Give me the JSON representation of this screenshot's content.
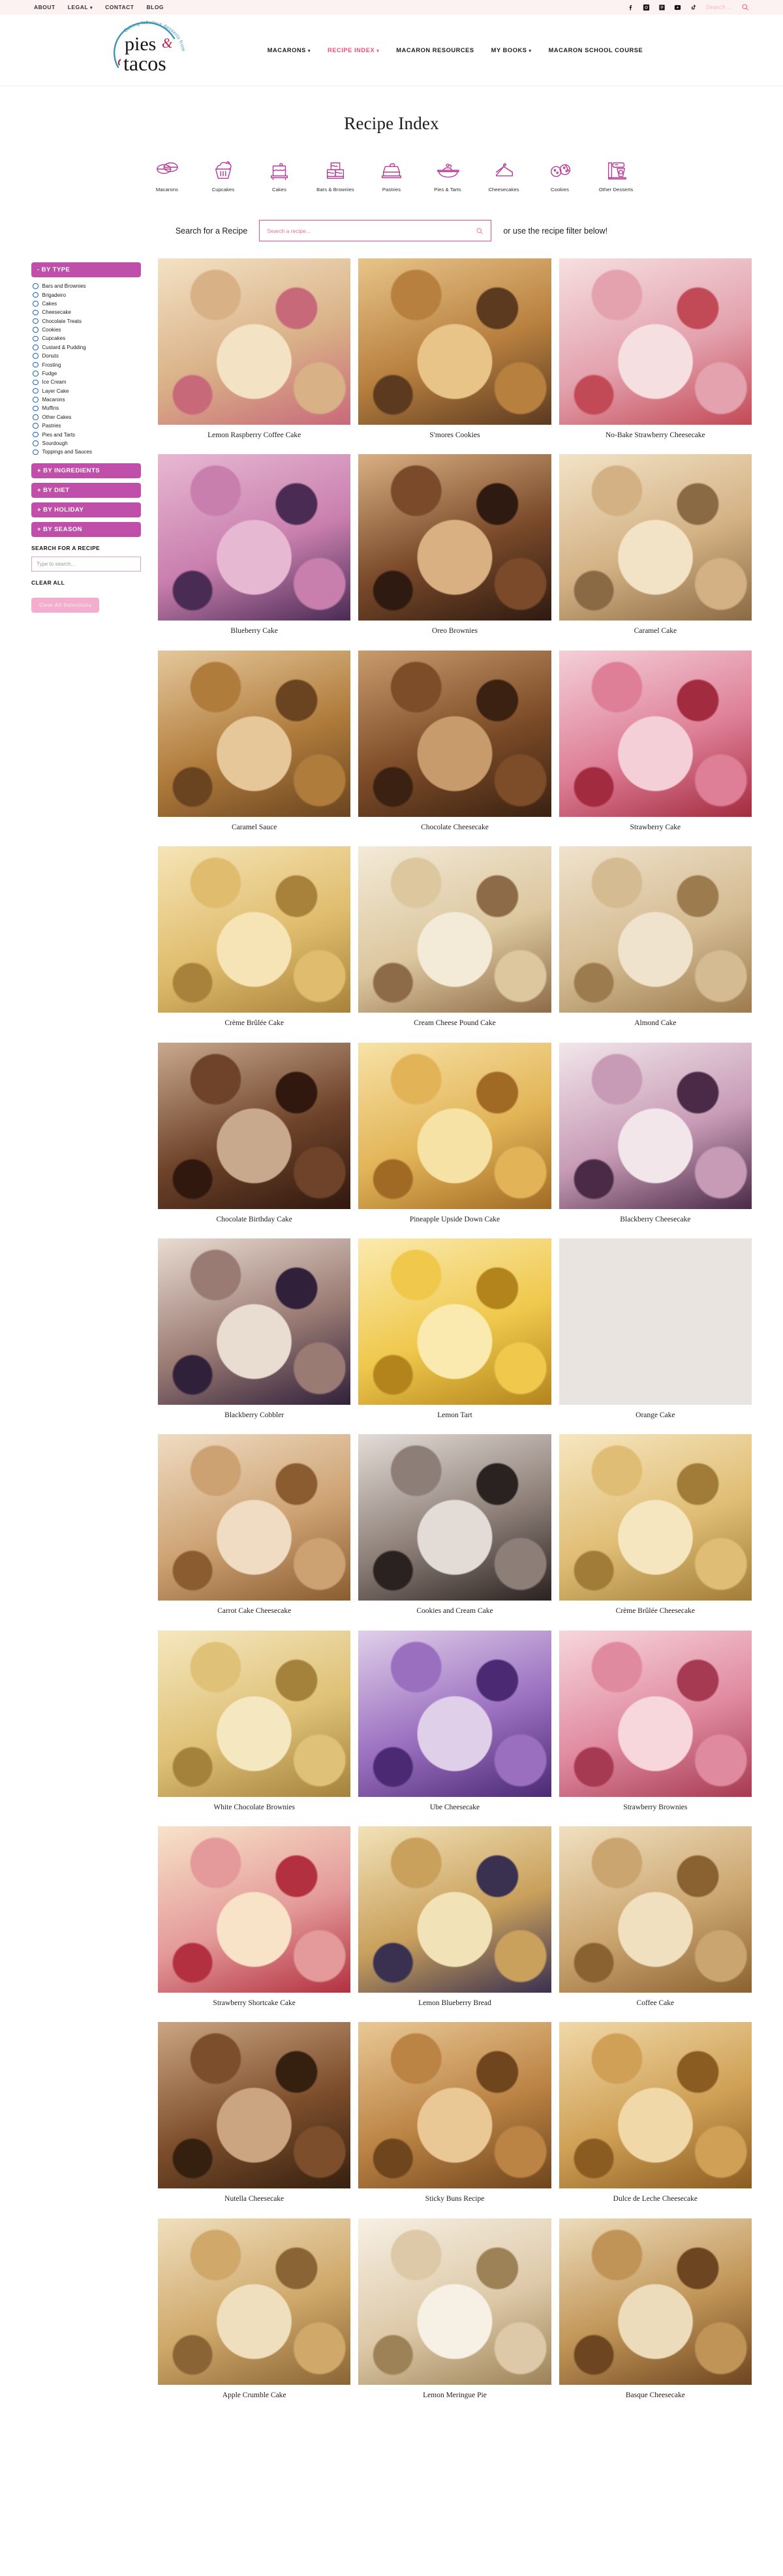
{
  "topbar": {
    "links": [
      {
        "label": "ABOUT",
        "caret": false
      },
      {
        "label": "LEGAL",
        "caret": true
      },
      {
        "label": "CONTACT",
        "caret": false
      },
      {
        "label": "BLOG",
        "caret": false
      }
    ],
    "social": [
      "facebook-icon",
      "instagram-icon",
      "pinterest-icon",
      "youtube-icon",
      "tiktok-icon"
    ],
    "search_placeholder": "Search ...",
    "search_value": ""
  },
  "brand": {
    "line1": "pies",
    "amp": "&",
    "line2": "tacos",
    "ring_text": "Baking fabulous desserts from scratch"
  },
  "mainnav": [
    {
      "label": "MACARONS",
      "caret": true,
      "active": false
    },
    {
      "label": "RECIPE INDEX",
      "caret": true,
      "active": true
    },
    {
      "label": "MACARON RESOURCES",
      "caret": false,
      "active": false
    },
    {
      "label": "MY BOOKS",
      "caret": true,
      "active": false
    },
    {
      "label": "MACARON SCHOOL COURSE",
      "caret": false,
      "active": false
    }
  ],
  "page": {
    "title": "Recipe Index",
    "accent": "#ef4d7e",
    "filter_purple": "#bf4fa8",
    "icon_purple": "#b63b9a"
  },
  "categories": [
    {
      "label": "Macarons",
      "icon": "macaron-icon"
    },
    {
      "label": "Cupcakes",
      "icon": "cupcake-icon"
    },
    {
      "label": "Cakes",
      "icon": "cake-icon"
    },
    {
      "label": "Bars & Brownies",
      "icon": "brownies-icon"
    },
    {
      "label": "Pastries",
      "icon": "pastry-icon"
    },
    {
      "label": "Pies & Tarts",
      "icon": "pie-icon"
    },
    {
      "label": "Cheesecakes",
      "icon": "cheesecake-slice-icon"
    },
    {
      "label": "Cookies",
      "icon": "cookies-icon"
    },
    {
      "label": "Other Desserts",
      "icon": "stand-mixer-icon"
    }
  ],
  "search": {
    "label": "Search for a Recipe",
    "placeholder": "Search a recipe...",
    "value": "",
    "tail": "or use the recipe filter below!"
  },
  "sidebar": {
    "by_type_header": "- BY TYPE",
    "types": [
      "Bars and Brownies",
      "Brigadeiro",
      "Cakes",
      "Cheesecake",
      "Chocolate Treats",
      "Cookies",
      "Cupcakes",
      "Custard & Pudding",
      "Donuts",
      "Frosting",
      "Fudge",
      "Ice Cream",
      "Layer Cake",
      "Macarons",
      "Muffins",
      "Other Cakes",
      "Pastries",
      "Pies and Tarts",
      "Sourdough",
      "Toppings and Sauces"
    ],
    "collapsed": [
      "+ BY INGREDIENTS",
      "+ BY DIET",
      "+ BY HOLIDAY",
      "+ BY SEASON"
    ],
    "search_label": "SEARCH FOR A RECIPE",
    "search_placeholder": "Type to search...",
    "search_value": "",
    "clear_label": "CLEAR ALL",
    "clear_button": "Clear All Selections"
  },
  "recipes": [
    {
      "title": "Lemon Raspberry Coffee Cake",
      "c1": "#f3e2c4",
      "c2": "#d9b187",
      "c3": "#c8697a"
    },
    {
      "title": "S'mores Cookies",
      "c1": "#e8c489",
      "c2": "#b8803f",
      "c3": "#5c3a20"
    },
    {
      "title": "No-Bake Strawberry Cheesecake",
      "c1": "#f6dfe0",
      "c2": "#e3a2ae",
      "c3": "#c24a56"
    },
    {
      "title": "Blueberry Cake",
      "c1": "#e7b8d2",
      "c2": "#c97fae",
      "c3": "#4a2b54"
    },
    {
      "title": "Oreo Brownies",
      "c1": "#d9b082",
      "c2": "#7a4a2a",
      "c3": "#2e1a10"
    },
    {
      "title": "Caramel Cake",
      "c1": "#f2e3c6",
      "c2": "#d3b184",
      "c3": "#8a6a44"
    },
    {
      "title": "Caramel Sauce",
      "c1": "#e5c79a",
      "c2": "#b07c3c",
      "c3": "#6a4420"
    },
    {
      "title": "Chocolate Cheesecake",
      "c1": "#c89b6c",
      "c2": "#7d4c28",
      "c3": "#3a2112"
    },
    {
      "title": "Strawberry Cake",
      "c1": "#f4cfd8",
      "c2": "#de7f97",
      "c3": "#a32b3f"
    },
    {
      "title": "Crème Brûlée Cake",
      "c1": "#f6e4b6",
      "c2": "#e0bd6e",
      "c3": "#a8823a"
    },
    {
      "title": "Cream Cheese Pound Cake",
      "c1": "#f3ead8",
      "c2": "#dcc79f",
      "c3": "#8e6b48"
    },
    {
      "title": "Almond Cake",
      "c1": "#f0e3cd",
      "c2": "#d4bb92",
      "c3": "#9c7b4e"
    },
    {
      "title": "Chocolate Birthday Cake",
      "c1": "#c9a98d",
      "c2": "#6e432a",
      "c3": "#30180e"
    },
    {
      "title": "Pineapple Upside Down Cake",
      "c1": "#f7e2a6",
      "c2": "#e2b457",
      "c3": "#a06a24"
    },
    {
      "title": "Blackberry Cheesecake",
      "c1": "#f2e6ea",
      "c2": "#c79bb6",
      "c3": "#4a2a46"
    },
    {
      "title": "Blackberry Cobbler",
      "c1": "#e9dcd0",
      "c2": "#9a7b74",
      "c3": "#30203a"
    },
    {
      "title": "Lemon Tart",
      "c1": "#fbeab0",
      "c2": "#efc84c",
      "c3": "#b3841c"
    },
    {
      "title": "Orange Cake",
      "c1": "#f7dfb6",
      "c2": "#e8a martin",
      "c3": "#b4621b"
    },
    {
      "title": "Carrot Cake Cheesecake",
      "c1": "#efdcc2",
      "c2": "#cda273",
      "c3": "#8a5c30"
    },
    {
      "title": "Cookies and Cream Cake",
      "c1": "#e3dcd6",
      "c2": "#8d7f78",
      "c3": "#2a2220"
    },
    {
      "title": "Crème Brûlée Cheesecake",
      "c1": "#f6e6c0",
      "c2": "#e0bd74",
      "c3": "#a07c38"
    },
    {
      "title": "White Chocolate Brownies",
      "c1": "#f5e7bf",
      "c2": "#dfc177",
      "c3": "#a4823c"
    },
    {
      "title": "Ube Cheesecake",
      "c1": "#e0cfe9",
      "c2": "#9a6fc0",
      "c3": "#4b2a73"
    },
    {
      "title": "Strawberry Brownies",
      "c1": "#f7d6dc",
      "c2": "#e08aa0",
      "c3": "#a63a52"
    },
    {
      "title": "Strawberry Shortcake Cake",
      "c1": "#f8e3c8",
      "c2": "#e49a9a",
      "c3": "#b2303f"
    },
    {
      "title": "Lemon Blueberry Bread",
      "c1": "#f2e2b8",
      "c2": "#c9a05c",
      "c3": "#3a3050"
    },
    {
      "title": "Coffee Cake",
      "c1": "#f0e0c0",
      "c2": "#cba56f",
      "c3": "#8a6232"
    },
    {
      "title": "Nutella Cheesecake",
      "c1": "#cba582",
      "c2": "#7d4e2c",
      "c3": "#35200f"
    },
    {
      "title": "Sticky Buns Recipe",
      "c1": "#e9c895",
      "c2": "#bb8344",
      "c3": "#6e451d"
    },
    {
      "title": "Dulce de Leche Cheesecake",
      "c1": "#f0d8a8",
      "c2": "#cfa055",
      "c3": "#8a5c22"
    },
    {
      "title": "Apple Crumble Cake",
      "c1": "#f0dfbe",
      "c2": "#cfa86a",
      "c3": "#8a6434"
    },
    {
      "title": "Lemon Meringue Pie",
      "c1": "#f7f0e4",
      "c2": "#ddc9a8",
      "c3": "#9d8257"
    },
    {
      "title": "Basque Cheesecake",
      "c1": "#eddcbc",
      "c2": "#c09456",
      "c3": "#6d4520"
    }
  ]
}
